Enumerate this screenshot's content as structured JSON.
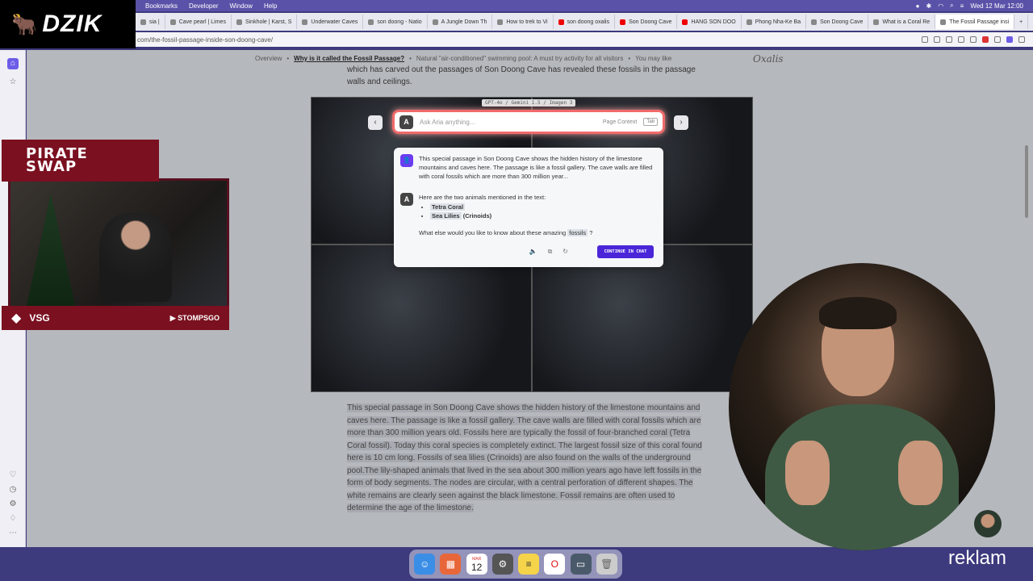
{
  "brand": {
    "name": "DZIK"
  },
  "menubar": {
    "menus": [
      "Bookmarks",
      "Developer",
      "Window",
      "Help"
    ],
    "clock": "Wed 12 Mar  12:00"
  },
  "tabs": [
    "sia | ",
    "Cave pearl | Limes",
    "Sinkhole | Karst, S",
    "Underwater Caves",
    "son doong - Natio",
    "A Jungle Down Th",
    "How to trek to Vi",
    "son doong oxalis",
    "Son Doong Cave",
    "HANG SON DOO",
    "Phong Nha-Ke Ba",
    "Son Doong Cave",
    "What is a Coral Re",
    "The Fossil Passage insi"
  ],
  "address": {
    "url": "com/the-fossil-passage-inside-son-doong-cave/"
  },
  "page": {
    "breadcrumb": [
      "Overview",
      "Why is it called the Fossil Passage?",
      "Natural \"air-conditioned\" swimming pool: A must try activity for all visitors",
      "You may like"
    ],
    "logo": "Oxalis",
    "intro_text": "which has carved out the passages of Son Doong Cave has revealed these fossils in the passage walls and ceilings.",
    "article_text": "This special passage in Son Doong Cave shows the hidden history of the limestone mountains and caves here. The passage is like a fossil gallery. The cave walls are filled with coral fossils which are more than 300 million years old. Fossils here are typically the fossil of four-branched coral (Tetra Coral fossil). Today this coral species is completely extinct. The largest fossil size of this coral found here is 10 cm long. Fossils of sea lilies (Crinoids) are also found on the walls of the underground pool.The lily-shaped animals that lived in the sea about 300 million years ago have left fossils in the form of body segments. The nodes are circular, with a central perforation of different shapes. The white remains are clearly seen against the black limestone. Fossil remains are often used to determine the age of the limestone."
  },
  "aria": {
    "model_badge": "GPT-4o / Gemini 1.5 / Imagen 3",
    "placeholder": "Ask Aria anything...",
    "context_label": "Page Context",
    "context_key": "Tab",
    "user_message": "This special passage in Son Doong Cave shows the hidden history of the limestone mountains and caves here. The passage is like a fossil gallery. The cave walls are filled with coral fossils which are more than 300 million year...",
    "answer_intro": "Here are the two animals mentioned in the text:",
    "animal1": "Tetra Coral",
    "animal2": "Sea Lilies",
    "animal2_suffix": "(Crinoids)",
    "follow_pre": "What else would you like to know about these amazing",
    "follow_hl": "fossils",
    "follow_post": "?",
    "continue_label": "CONTINUE IN CHAT"
  },
  "webcam": {
    "overlay_title_line1": "PIRATE",
    "overlay_title_line2": "SWAP",
    "channel": "STOMPSGO",
    "badge": "VSG"
  },
  "dock": {
    "calendar_month": "MAR",
    "calendar_day": "12"
  },
  "watermark": "reklam",
  "colors": {
    "accent": "#4a26d8",
    "menubar": "#5a52a8",
    "aria_border": "#f06a6a"
  }
}
